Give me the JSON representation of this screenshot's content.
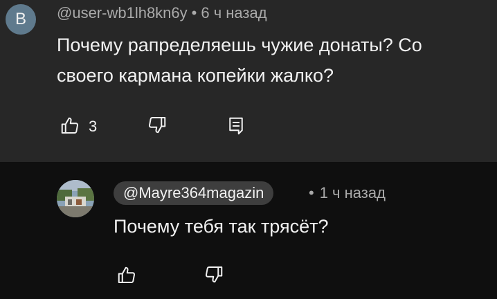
{
  "comment": {
    "avatar_letter": "B",
    "handle": "@user-wb1lh8kn6y",
    "separator": "•",
    "time": "6 ч назад",
    "text_line1": "Почему рапределяешь чужие донаты? Со",
    "text_line2": "своего кармана копейки жалко?",
    "like_count": "3",
    "icons": {
      "like": "thumb-up-icon",
      "dislike": "thumb-down-icon",
      "reply": "reply-comment-icon"
    }
  },
  "reply": {
    "handle": "@Mayre364magazin",
    "separator": "•",
    "time": "1 ч назад",
    "text": "Почему тебя так трясёт?",
    "icons": {
      "like": "thumb-up-icon",
      "dislike": "thumb-down-icon"
    }
  },
  "colors": {
    "top_background": "#272727",
    "bottom_background": "#0f0f0f",
    "avatar_background": "#5f7a8d",
    "chip_background": "#3e3e3e",
    "text_primary": "#f1f1f1",
    "text_secondary": "#aaaaaa"
  }
}
